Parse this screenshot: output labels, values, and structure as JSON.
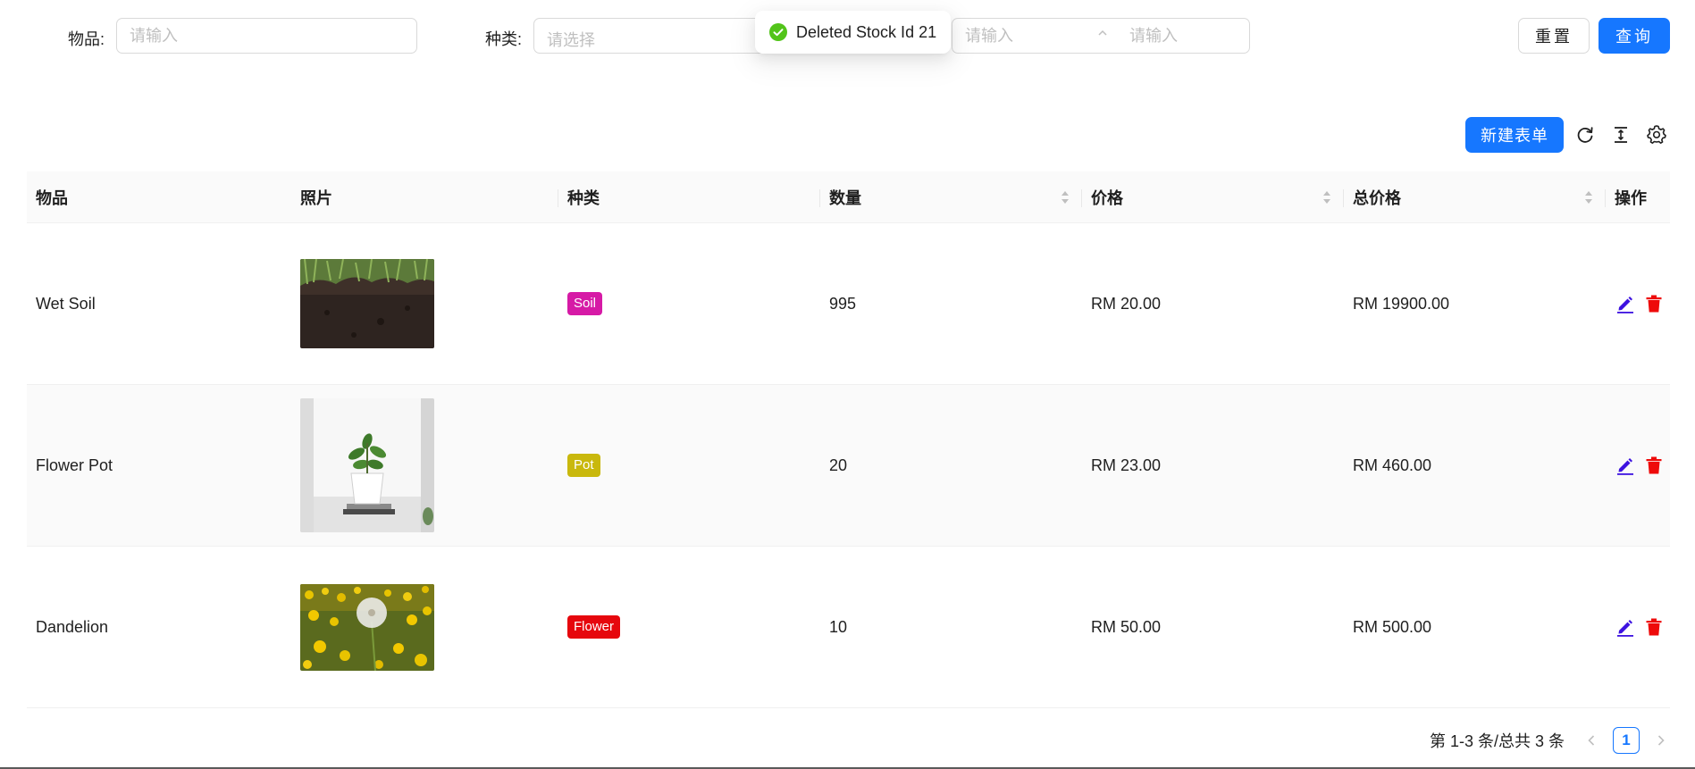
{
  "search": {
    "item_label": "物品:",
    "item_placeholder": "请输入",
    "category_label": "种类:",
    "category_placeholder": "请选择",
    "range_from_placeholder": "请输入",
    "range_separator": "^",
    "range_to_placeholder": "请输入",
    "reset_label": "重置",
    "query_label": "查询"
  },
  "toast": {
    "icon": "check-circle-icon",
    "message": "Deleted Stock Id 21",
    "color": "#52c41a"
  },
  "toolbar": {
    "new_label": "新建表单",
    "icons": [
      "reload-icon",
      "column-height-icon",
      "setting-icon"
    ]
  },
  "table": {
    "columns": [
      "物品",
      "照片",
      "种类",
      "数量",
      "价格",
      "总价格",
      "操作"
    ],
    "rows": [
      {
        "name": "Wet Soil",
        "photo": "wet-soil-photo",
        "category": "Soil",
        "category_color": "#d61aa6",
        "quantity": "995",
        "price": "RM 20.00",
        "total": "RM 19900.00"
      },
      {
        "name": "Flower Pot",
        "photo": "flower-pot-photo",
        "category": "Pot",
        "category_color": "#c9b80d",
        "quantity": "20",
        "price": "RM 23.00",
        "total": "RM 460.00"
      },
      {
        "name": "Dandelion",
        "photo": "dandelion-photo",
        "category": "Flower",
        "category_color": "#e6070d",
        "quantity": "10",
        "price": "RM 50.00",
        "total": "RM 500.00"
      }
    ],
    "actions": {
      "edit_icon": "edit-icon",
      "delete_icon": "delete-icon",
      "edit_color": "#3d12e0",
      "delete_color": "#ee0a0a"
    }
  },
  "pagination": {
    "total_text": "第 1-3 条/总共 3 条",
    "current_page": "1"
  },
  "colors": {
    "primary": "#1677ff"
  }
}
